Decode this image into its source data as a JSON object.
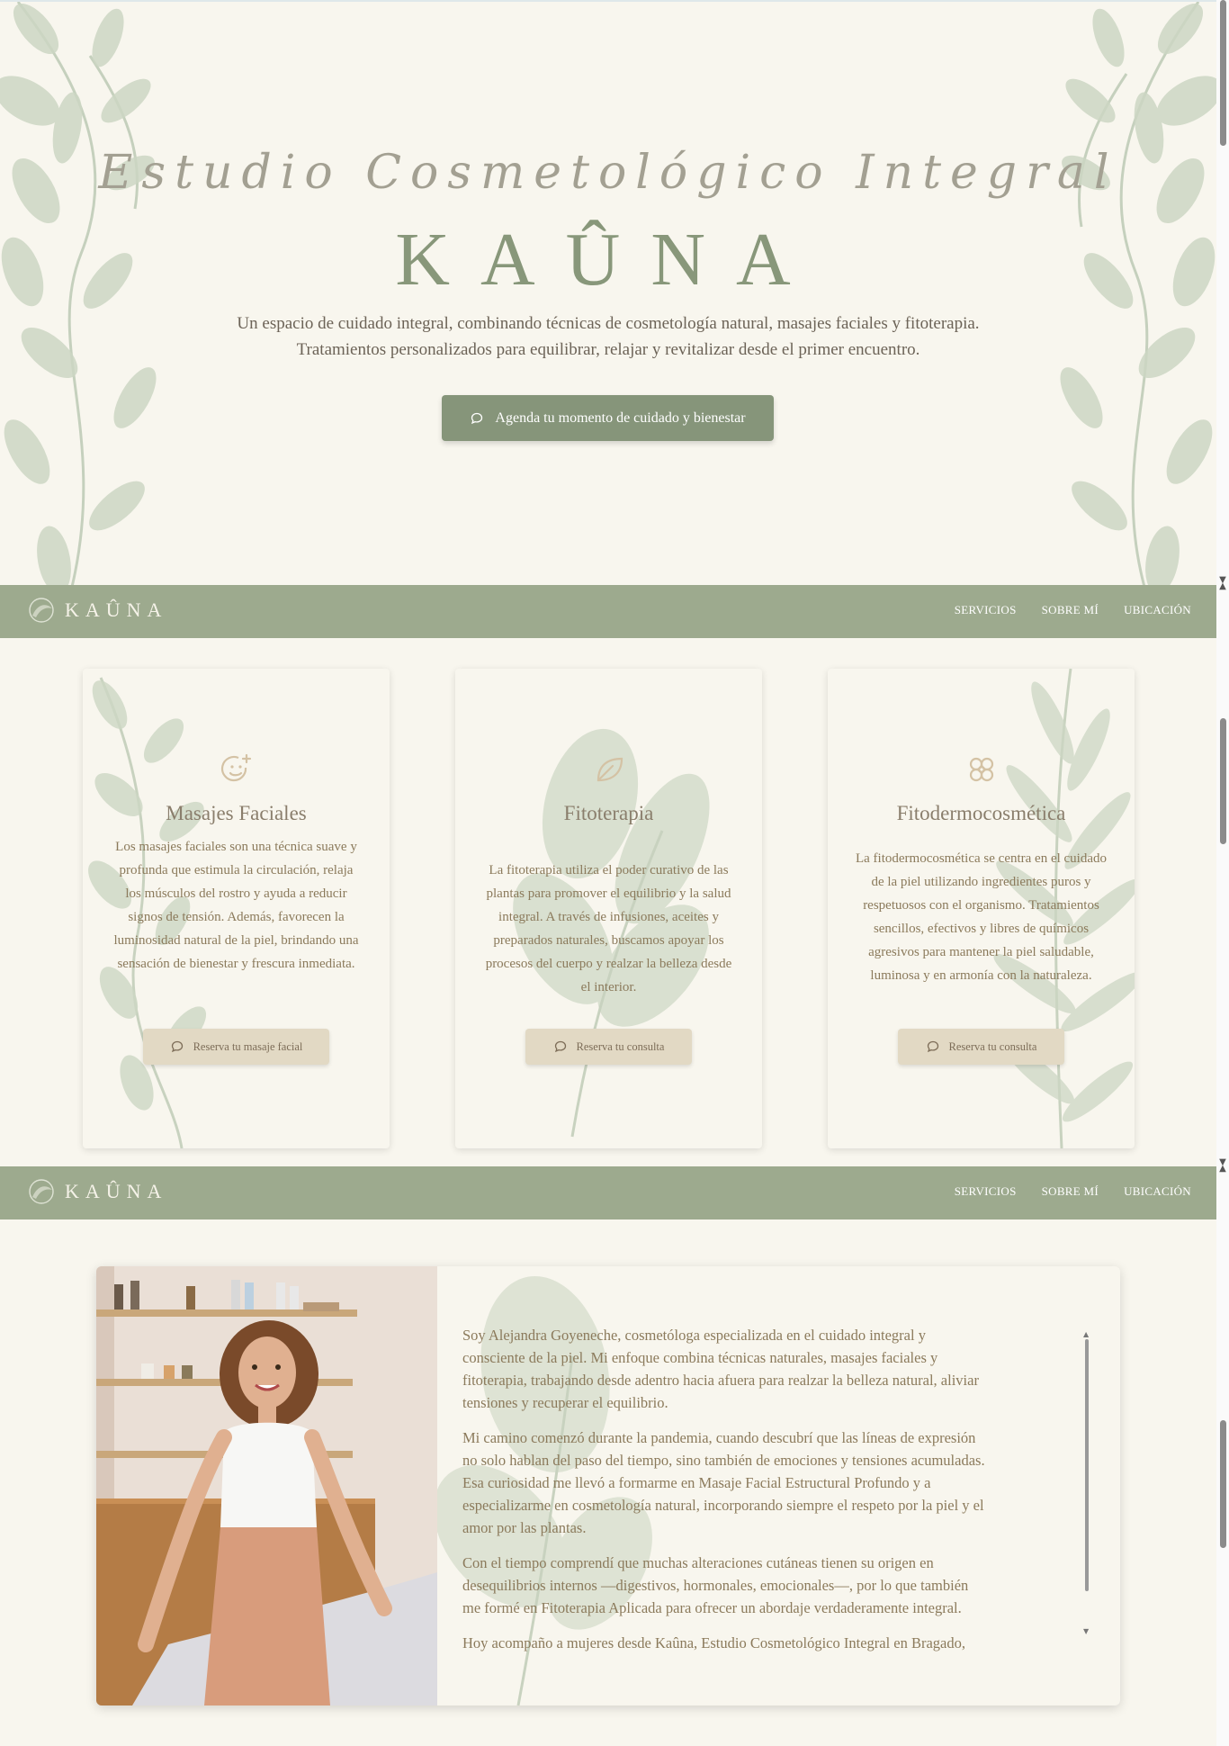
{
  "hero": {
    "subtitle": "Estudio Cosmetológico Integral",
    "title": "KAÛNA",
    "description_line1": "Un espacio de cuidado integral, combinando técnicas de cosmetología natural, masajes faciales y fitoterapia.",
    "description_line2": "Tratamientos personalizados para equilibrar, relajar y revitalizar desde el primer encuentro.",
    "cta_label": "Agenda tu momento de cuidado y bienestar"
  },
  "nav": {
    "logo_text": "KAÛNA",
    "links": [
      "SERVICIOS",
      "SOBRE MÍ",
      "UBICACIÓN"
    ]
  },
  "services": [
    {
      "title": "Masajes Faciales",
      "icon": "smile-plus-icon",
      "text": "Los masajes faciales son una técnica suave y profunda que estimula la circulación, relaja los músculos del rostro y ayuda a reducir signos de tensión. Además, favorecen la luminosidad natural de la piel, brindando una sensación de bienestar y frescura inmediata.",
      "button": "Reserva tu masaje facial"
    },
    {
      "title": "Fitoterapia",
      "icon": "leaf-icon",
      "text": "La fitoterapia utiliza el poder curativo de las plantas para promover el equilibrio y la salud integral. A través de infusiones, aceites y preparados naturales, buscamos apoyar los procesos del cuerpo y realzar la belleza desde el interior.",
      "button": "Reserva tu consulta"
    },
    {
      "title": "Fitodermocosmética",
      "icon": "flower-icon",
      "text": "La fitodermocosmética se centra en el cuidado de la piel utilizando ingredientes puros y respetuosos con el organismo. Tratamientos sencillos, efectivos y libres de químicos agresivos para mantener la piel saludable, luminosa y en armonía con la naturaleza.",
      "button": "Reserva tu consulta"
    }
  ],
  "about": {
    "paragraphs": [
      "Soy Alejandra Goyeneche, cosmetóloga especializada en el cuidado integral y consciente de la piel. Mi enfoque combina técnicas naturales, masajes faciales y fitoterapia, trabajando desde adentro hacia afuera para realzar la belleza natural, aliviar tensiones y recuperar el equilibrio.",
      "Mi camino comenzó durante la pandemia, cuando descubrí que las líneas de expresión no solo hablan del paso del tiempo, sino también de emociones y tensiones acumuladas. Esa curiosidad me llevó a formarme en Masaje Facial Estructural Profundo y a especializarme en cosmetología natural, incorporando siempre el respeto por la piel y el amor por las plantas.",
      "Con el tiempo comprendí que muchas alteraciones cutáneas tienen su origen en desequilibrios internos —digestivos, hormonales, emocionales—, por lo que también me formé en Fitoterapia Aplicada para ofrecer un abordaje verdaderamente integral.",
      "Hoy acompaño a mujeres desde Kaûna, Estudio Cosmetológico Integral en Bragado, con sesiones personalizadas, protocolos de fitodermocosmética y asesorías presenciales u online de automasaje, cuidado facial y uso de plantas medicinales."
    ]
  },
  "colors": {
    "background": "#f8f6ee",
    "nav": "#9daa8e",
    "cta": "#86957a",
    "title": "#88977a",
    "card_button": "#e2d9c4",
    "body_text": "#8b7a5b"
  }
}
